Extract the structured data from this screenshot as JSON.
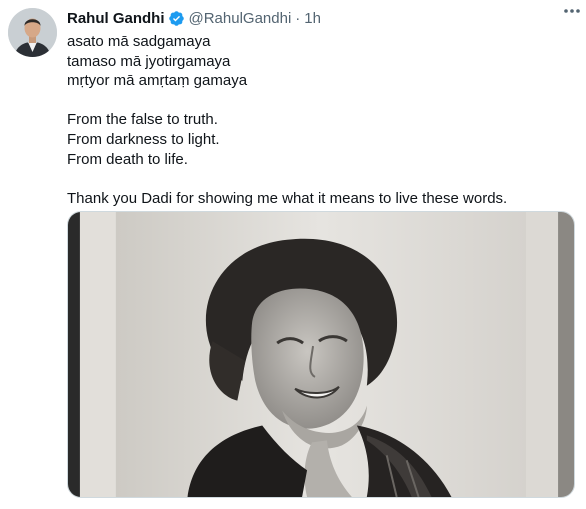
{
  "tweet": {
    "author": {
      "name": "Rahul Gandhi",
      "handle": "@RahulGandhi",
      "verified_icon": "verified-badge-icon",
      "avatar": "avatar"
    },
    "separator": "·",
    "time": "1h",
    "more_icon": "more-options-icon",
    "lines": [
      "asato mā sadgamaya",
      "tamaso mā jyotirgamaya",
      "mṛtyor mā amṛtaṃ gamaya",
      "",
      "From the false to truth.",
      "From darkness to light.",
      "From death to life.",
      "",
      "Thank you Dadi for showing me what it means to live these words."
    ],
    "media": {
      "kind": "black-and-white portrait photograph"
    }
  },
  "colors": {
    "text": "#0f1419",
    "secondary": "#536471",
    "verified": "#1d9bf0",
    "border": "#cfd9de"
  }
}
